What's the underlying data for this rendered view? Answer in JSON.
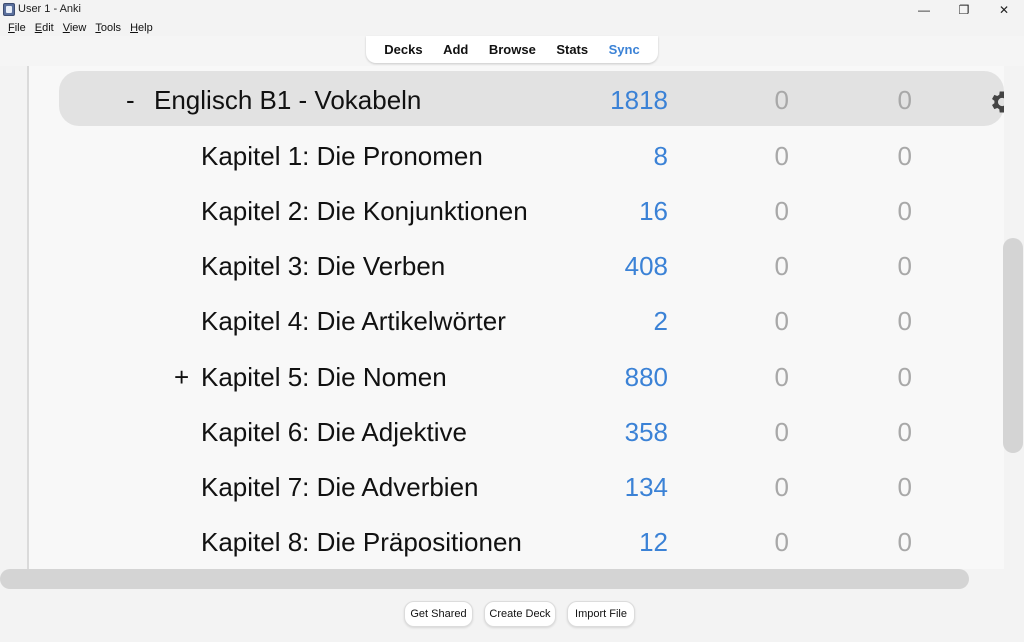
{
  "window": {
    "title": "User 1 - Anki",
    "minimize": "—",
    "maximize": "❐",
    "close": "✕"
  },
  "menu": [
    {
      "label_first": "F",
      "label_rest": "ile"
    },
    {
      "label_first": "E",
      "label_rest": "dit"
    },
    {
      "label_first": "V",
      "label_rest": "iew"
    },
    {
      "label_first": "T",
      "label_rest": "ools"
    },
    {
      "label_first": "H",
      "label_rest": "elp"
    }
  ],
  "toolbar": {
    "decks": "Decks",
    "add": "Add",
    "browse": "Browse",
    "stats": "Stats",
    "sync": "Sync"
  },
  "decks": {
    "current": {
      "prefix": "-",
      "name": "Englisch B1 - Vokabeln",
      "new": "1818",
      "learn": "0",
      "due": "0"
    },
    "children": [
      {
        "prefix": "",
        "name": "Kapitel 1: Die Pronomen",
        "new": "8",
        "learn": "0",
        "due": "0"
      },
      {
        "prefix": "",
        "name": "Kapitel 2: Die Konjunktionen",
        "new": "16",
        "learn": "0",
        "due": "0"
      },
      {
        "prefix": "",
        "name": "Kapitel 3: Die Verben",
        "new": "408",
        "learn": "0",
        "due": "0"
      },
      {
        "prefix": "",
        "name": "Kapitel 4: Die Artikelwörter",
        "new": "2",
        "learn": "0",
        "due": "0"
      },
      {
        "prefix": "+",
        "name": "Kapitel 5: Die Nomen",
        "new": "880",
        "learn": "0",
        "due": "0"
      },
      {
        "prefix": "",
        "name": "Kapitel 6: Die Adjektive",
        "new": "358",
        "learn": "0",
        "due": "0"
      },
      {
        "prefix": "",
        "name": "Kapitel 7: Die Adverbien",
        "new": "134",
        "learn": "0",
        "due": "0"
      },
      {
        "prefix": "",
        "name": "Kapitel 8: Die Präpositionen",
        "new": "12",
        "learn": "0",
        "due": "0"
      }
    ]
  },
  "bottom": {
    "get_shared": "Get Shared",
    "create_deck": "Create Deck",
    "import_file": "Import File"
  },
  "colors": {
    "new_count": "#3b82d6",
    "zero_count": "#a8a8a8",
    "current_row": "#e2e2e2"
  },
  "icons": {
    "options": "gear-icon"
  }
}
